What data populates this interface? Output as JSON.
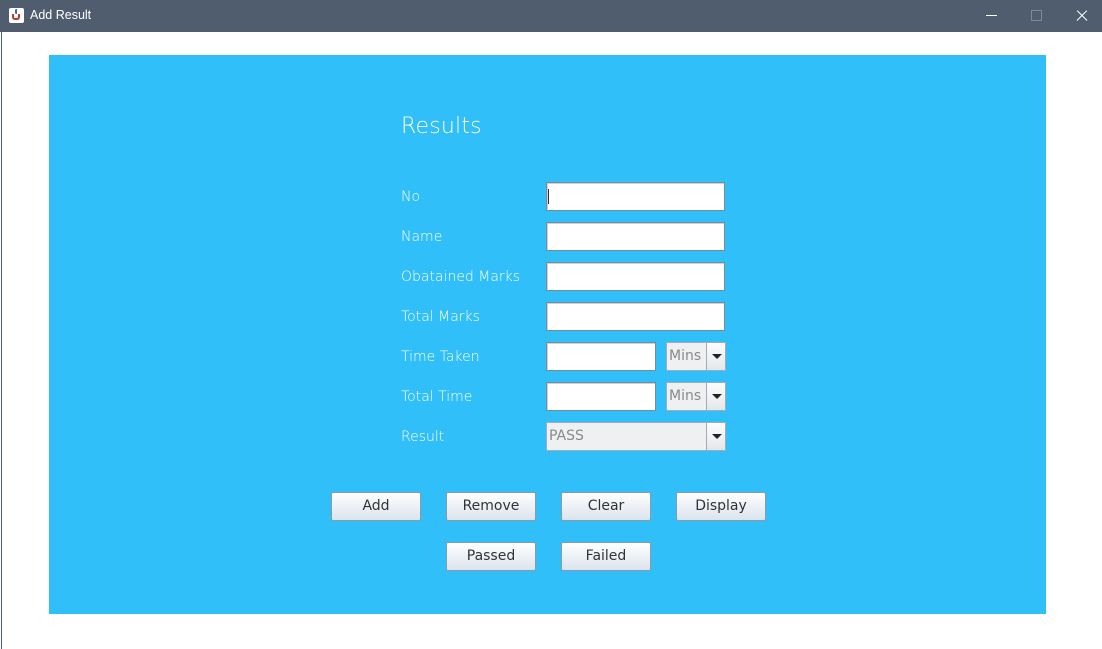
{
  "window": {
    "title": "Add Result",
    "icon": "java-cup-icon"
  },
  "form": {
    "heading": "Results",
    "fields": {
      "no": {
        "label": "No",
        "value": ""
      },
      "name": {
        "label": "Name",
        "value": ""
      },
      "obtained_marks": {
        "label": "Obatained Marks",
        "value": ""
      },
      "total_marks": {
        "label": "Total Marks",
        "value": ""
      },
      "time_taken": {
        "label": "Time Taken",
        "value": "",
        "unit": "Mins"
      },
      "total_time": {
        "label": "Total Time",
        "value": "",
        "unit": "Mins"
      },
      "result": {
        "label": "Result",
        "selected": "PASS"
      }
    },
    "buttons": {
      "add": "Add",
      "remove": "Remove",
      "clear": "Clear",
      "display": "Display",
      "passed": "Passed",
      "failed": "Failed"
    }
  },
  "colors": {
    "panel": "#30bff8",
    "titlebar": "#4f5d6e"
  }
}
